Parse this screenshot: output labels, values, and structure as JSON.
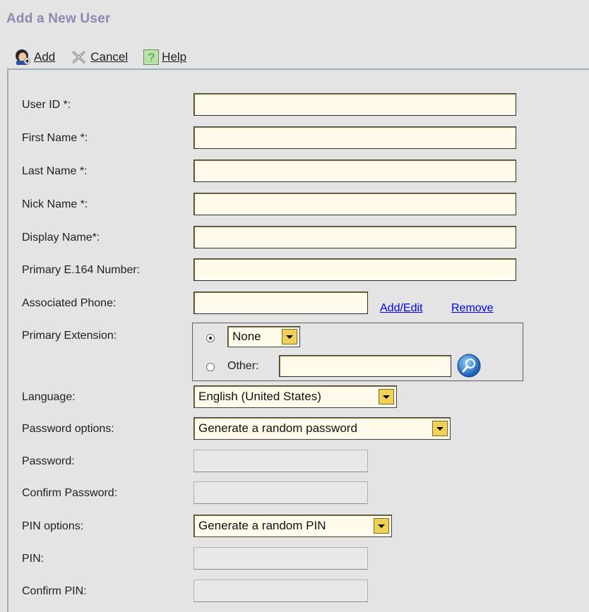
{
  "page": {
    "title": "Add a New User"
  },
  "toolbar": {
    "add_label": "Add",
    "cancel_label": "Cancel",
    "help_label": "Help"
  },
  "form": {
    "user_id_label": "User ID *:",
    "first_name_label": "First Name *:",
    "last_name_label": "Last Name *:",
    "nick_name_label": "Nick Name *:",
    "display_name_label": "Display Name*:",
    "primary_e164_label": "Primary E.164 Number:",
    "associated_phone_label": "Associated Phone:",
    "add_edit_link": "Add/Edit",
    "remove_link": "Remove",
    "primary_extension_label": "Primary Extension:",
    "extension_none_value": "None",
    "extension_other_label": "Other:",
    "language_label": "Language:",
    "language_value": "English (United States)",
    "password_options_label": "Password options:",
    "password_options_value": "Generate a random password",
    "password_label": "Password:",
    "confirm_password_label": "Confirm Password:",
    "pin_options_label": "PIN options:",
    "pin_options_value": "Generate a random PIN",
    "pin_label": "PIN:",
    "confirm_pin_label": "Confirm PIN:"
  },
  "colors": {
    "title": "#8a8ab0",
    "field_bg": "#fffaea",
    "select_button": "#f0d058",
    "link": "#0000ee"
  },
  "icons": {
    "add": "add-user-icon",
    "cancel": "close-x-icon",
    "help": "help-question-icon",
    "search": "search-icon"
  }
}
